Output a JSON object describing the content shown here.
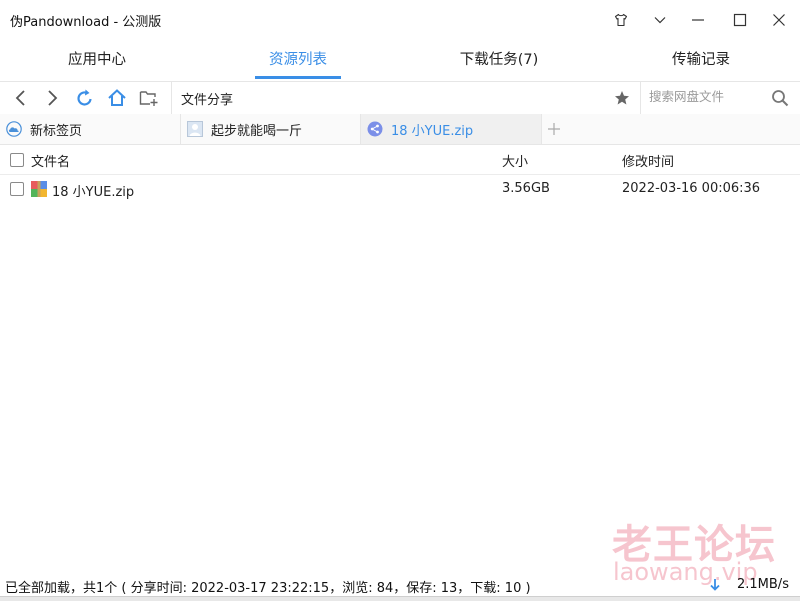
{
  "window": {
    "title": "伪Pandownload - 公测版",
    "controls": [
      "shirt-icon",
      "chevron-down-icon",
      "minimize-icon",
      "maximize-icon",
      "close-icon"
    ]
  },
  "main_tabs": [
    {
      "label": "应用中心",
      "active": false
    },
    {
      "label": "资源列表",
      "active": true
    },
    {
      "label": "下载任务(7)",
      "active": false
    },
    {
      "label": "传输记录",
      "active": false
    }
  ],
  "toolbar": {
    "buttons": [
      "back-icon",
      "forward-icon",
      "refresh-icon",
      "home-icon",
      "new-folder-icon"
    ],
    "path": "文件分享",
    "search_placeholder": "搜索网盘文件",
    "accent_color": "#3a8ee6"
  },
  "sub_tabs": [
    {
      "label": "新标签页",
      "icon": "cloud-icon",
      "active": false
    },
    {
      "label": "起步就能喝一斤",
      "icon": "avatar-icon",
      "active": false
    },
    {
      "label": "18 小YUE.zip",
      "icon": "share-icon",
      "active": true
    }
  ],
  "file_list": {
    "columns": {
      "name": "文件名",
      "size": "大小",
      "modified": "修改时间"
    },
    "rows": [
      {
        "name": "18 小YUE.zip",
        "size": "3.56GB",
        "modified": "2022-03-16 00:06:36",
        "icon": "zip-archive-icon"
      }
    ]
  },
  "watermark": {
    "line1": "老王论坛",
    "line2": "laowang.vip"
  },
  "status": {
    "text": "已全部加载，共1个 ( 分享时间: 2022-03-17 23:22:15，浏览: 84，保存: 13，下载: 10 )",
    "speed": "2.1MB/s"
  }
}
